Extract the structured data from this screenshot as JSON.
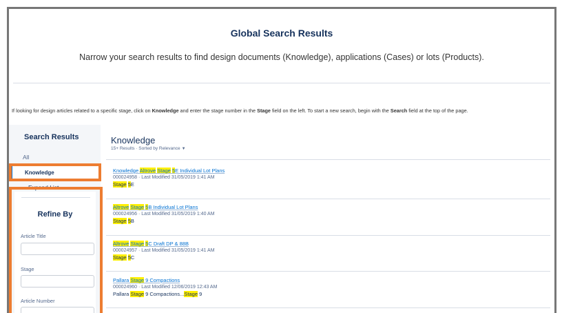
{
  "header": {
    "title": "Global Search Results",
    "subtitle": "Narrow your search results to find design documents (Knowledge), applications (Cases) or lots (Products)."
  },
  "hint": {
    "p1": "If looking for design articles related to a specific stage, click on ",
    "b1": "Knowledge",
    "p2": " and enter the stage number in the ",
    "b2": "Stage",
    "p3": " field on the left. To start a new search, begin with the ",
    "b3": "Search",
    "p4": " field at the top of the page."
  },
  "sidebar": {
    "title": "Search Results",
    "items": [
      {
        "label": "All"
      },
      {
        "label": "Knowledge"
      },
      {
        "label": "Expand List"
      }
    ]
  },
  "refine": {
    "title": "Refine By",
    "fields": [
      {
        "label": "Article Title",
        "value": ""
      },
      {
        "label": "Stage",
        "value": ""
      },
      {
        "label": "Article Number",
        "value": ""
      }
    ]
  },
  "results": {
    "title": "Knowledge",
    "meta": "15+ Results · Sorted by Relevance",
    "items": [
      {
        "title_parts": [
          "Knowledge ",
          "Altrove",
          " ",
          "Stage",
          " ",
          "5",
          "E Individual Lot Plans"
        ],
        "number": "000024958",
        "modified": "Last Modified  31/05/2019 1:41 AM",
        "snippet_parts": [
          "Stage",
          " ",
          "5",
          "E"
        ]
      },
      {
        "title_parts": [
          "Altrove",
          " ",
          "Stage",
          " ",
          "5",
          "B Individual Lot Plans"
        ],
        "number": "000024956",
        "modified": "Last Modified  31/05/2019 1:40 AM",
        "snippet_parts": [
          "Stage",
          " ",
          "5",
          "B"
        ]
      },
      {
        "title_parts": [
          "Altrove",
          " ",
          "Stage",
          " ",
          "5",
          "C Draft DP & 88B"
        ],
        "number": "000024957",
        "modified": "Last Modified  31/05/2019 1:41 AM",
        "snippet_parts": [
          "Stage",
          " ",
          "5",
          "C"
        ]
      },
      {
        "title_parts": [
          "Pallara ",
          "Stage",
          " 9 Compactions"
        ],
        "number": "000024960",
        "modified": "Last Modified  12/06/2019 12:43 AM",
        "snippet_parts": [
          "Pallara ",
          "Stage",
          " 9 Compactions...",
          "Stage",
          " 9"
        ]
      }
    ]
  },
  "colors": {
    "highlight": "#ffef00",
    "callout_border": "#ed7d31",
    "accent": "#0070d2",
    "heading": "#16325c"
  }
}
